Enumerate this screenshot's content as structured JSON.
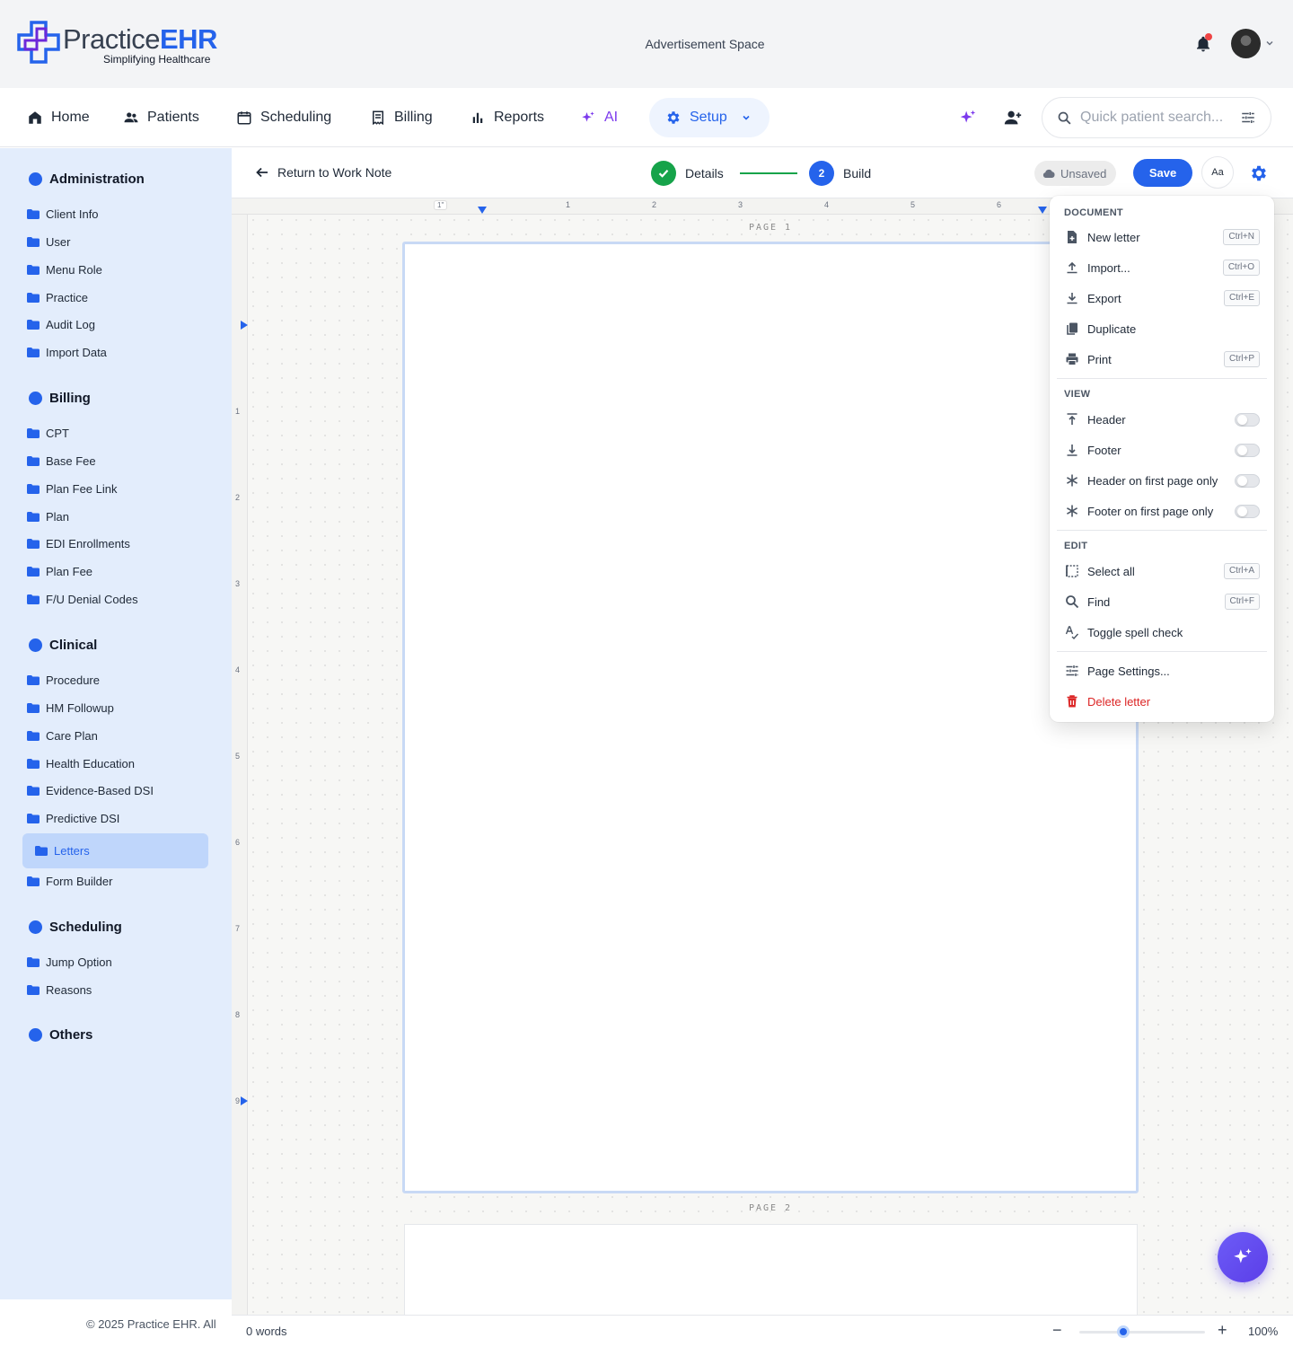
{
  "header": {
    "logo_word_1": "Practice",
    "logo_word_2": "EHR",
    "logo_tagline": "Simplifying Healthcare",
    "ad_text": "Advertisement Space"
  },
  "nav": {
    "home": "Home",
    "patients": "Patients",
    "scheduling": "Scheduling",
    "billing": "Billing",
    "reports": "Reports",
    "ai": "AI",
    "setup": "Setup",
    "search_placeholder": "Quick patient search..."
  },
  "sidebar": {
    "sections": {
      "administration": "Administration",
      "billing": "Billing",
      "clinical": "Clinical",
      "scheduling": "Scheduling",
      "others": "Others"
    },
    "administration_items": [
      "Client Info",
      "User",
      "Menu Role",
      "Practice",
      "Audit Log",
      "Import Data"
    ],
    "billing_items": [
      "CPT",
      "Base Fee",
      "Plan Fee Link",
      "Plan",
      "EDI Enrollments",
      "Plan Fee",
      "F/U Denial Codes"
    ],
    "clinical_items": [
      "Procedure",
      "HM Followup",
      "Care Plan",
      "Health Education",
      "Evidence-Based DSI",
      "Predictive DSI",
      "Letters",
      "Form Builder"
    ],
    "scheduling_items": [
      "Jump Option",
      "Reasons"
    ],
    "active_item": "Letters",
    "footer": "© 2025 Practice EHR. All"
  },
  "toolbar": {
    "back_label": "Return to Work Note",
    "step1_label": "Details",
    "step2_number": "2",
    "step2_label": "Build",
    "status": "Unsaved",
    "save_label": "Save",
    "font_button": "Aa"
  },
  "ruler": {
    "top_margin_label": "1\"",
    "h_ticks": [
      "1",
      "2",
      "3",
      "4",
      "5",
      "6"
    ],
    "v_ticks": [
      "1",
      "2",
      "3",
      "4",
      "5",
      "6",
      "7",
      "8",
      "9"
    ]
  },
  "pages": {
    "page1_label": "PAGE 1",
    "page2_label": "PAGE 2"
  },
  "statusbar": {
    "words": "0 words",
    "zoom_minus": "−",
    "zoom_plus": "+",
    "zoom_value": "100%",
    "zoom_fraction": 0.35
  },
  "menu": {
    "document_title": "DOCUMENT",
    "view_title": "VIEW",
    "edit_title": "EDIT",
    "new_letter": "New letter",
    "new_letter_kbd": "Ctrl+N",
    "import": "Import...",
    "import_kbd": "Ctrl+O",
    "export": "Export",
    "export_kbd": "Ctrl+E",
    "duplicate": "Duplicate",
    "print": "Print",
    "print_kbd": "Ctrl+P",
    "header": "Header",
    "footer": "Footer",
    "header_first": "Header on first page only",
    "footer_first": "Footer on first page only",
    "select_all": "Select all",
    "select_all_kbd": "Ctrl+A",
    "find": "Find",
    "find_kbd": "Ctrl+F",
    "spell_check": "Toggle spell check",
    "page_settings": "Page Settings...",
    "delete_letter": "Delete letter"
  },
  "colors": {
    "accent": "#2563eb",
    "success": "#16a34a",
    "danger": "#dc2626",
    "ai": "#7c3aed"
  }
}
